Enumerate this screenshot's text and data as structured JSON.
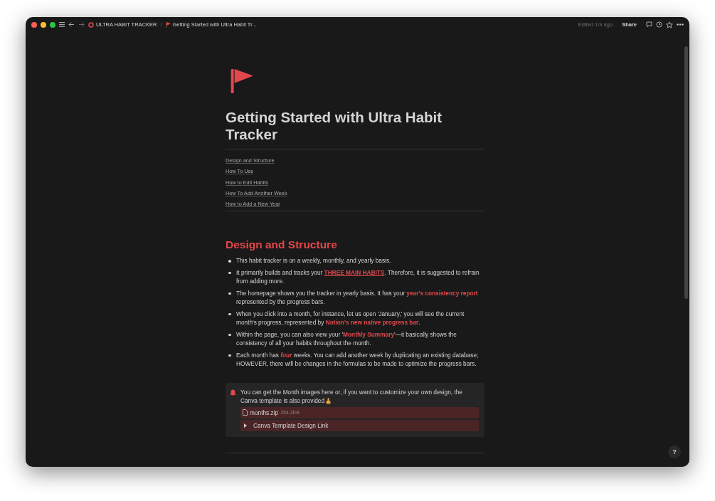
{
  "topbar": {
    "breadcrumbs": [
      {
        "label": "ULTRA HABIT TRACKER",
        "kind": "workspace"
      },
      {
        "label": "Getting Started with Ultra Habit Tr...",
        "kind": "page"
      }
    ],
    "separator": "/",
    "edited": "Edited 1m ago",
    "share": "Share"
  },
  "page": {
    "title": "Getting Started with Ultra Habit Tracker",
    "toc": [
      "Design and Structure",
      "How To Use",
      "How to Edit Habits",
      "How To Add Another Week",
      "How to Add a New Year"
    ],
    "section": {
      "heading": "Design and Structure",
      "bullets": [
        [
          {
            "kind": "plain",
            "text": "This habit tracker is on a weekly, monthly, and yearly basis."
          }
        ],
        [
          {
            "kind": "plain",
            "text": "It primarily builds and tracks your "
          },
          {
            "kind": "link",
            "text": "THREE MAIN HABITS"
          },
          {
            "kind": "plain",
            "text": ". Therefore, it is suggested to refrain from adding more."
          }
        ],
        [
          {
            "kind": "plain",
            "text": "The homepage shows you the tracker in yearly basis. It has your "
          },
          {
            "kind": "highlight",
            "text": "year's consistency report"
          },
          {
            "kind": "plain",
            "text": " represented by the progress bars."
          }
        ],
        [
          {
            "kind": "plain",
            "text": "When you click into a month, for instance, let us open 'January,' you will see the current month's progress, represented by "
          },
          {
            "kind": "highlight",
            "text": "Notion's new native progress bar"
          },
          {
            "kind": "plain",
            "text": "."
          }
        ],
        [
          {
            "kind": "plain",
            "text": "Within the page, you can also view your '"
          },
          {
            "kind": "highlight",
            "text": "Monthly Summary"
          },
          {
            "kind": "plain",
            "text": "'—it basically shows the consistency of all your habits throughout the month."
          }
        ],
        [
          {
            "kind": "plain",
            "text": "Each month has "
          },
          {
            "kind": "emphasis",
            "text": "four"
          },
          {
            "kind": "plain",
            "text": " weeks. You can add another week by duplicating an existing database; HOWEVER, there will be changes in the formulas to be made to optimize the progress bars."
          }
        ]
      ]
    },
    "callout": {
      "text": "You can get the Month images here or, if you want to customize your own design, the Canva template is also provided",
      "file": {
        "name": "months.zip",
        "size": "254.3KB"
      },
      "toggle": {
        "label": "Canva Template Design Link",
        "expanded": false
      }
    }
  },
  "help": "?"
}
